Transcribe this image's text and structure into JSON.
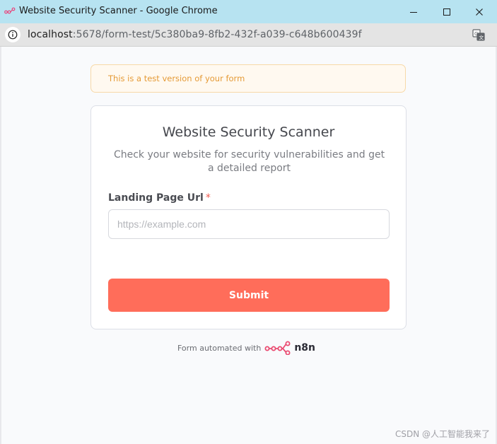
{
  "window": {
    "title": "Website Security Scanner - Google Chrome",
    "minimize_icon": "minimize-icon",
    "maximize_icon": "maximize-icon",
    "close_icon": "close-icon"
  },
  "address_bar": {
    "host": "localhost",
    "path": ":5678/form-test/5c380ba9-8fb2-432f-a039-c648b600439f",
    "site_info_icon": "info-icon",
    "translate_icon": "translate-icon"
  },
  "banner": {
    "text": "This is a test version of your form"
  },
  "form": {
    "title": "Website Security Scanner",
    "description": "Check your website for security vulnerabilities and get a detailed report",
    "fields": [
      {
        "label": "Landing Page Url",
        "required_marker": "*",
        "placeholder": "https://example.com",
        "value": ""
      }
    ],
    "submit_label": "Submit"
  },
  "footer": {
    "text": "Form automated with",
    "brand": "n8n",
    "logo_icon": "n8n-logo-icon"
  },
  "watermark": "CSDN @人工智能我来了",
  "colors": {
    "accent": "#ff6d5a",
    "banner_text": "#e59a36",
    "banner_bg": "#fff9f0",
    "titlebar": "#b7e3f1"
  }
}
